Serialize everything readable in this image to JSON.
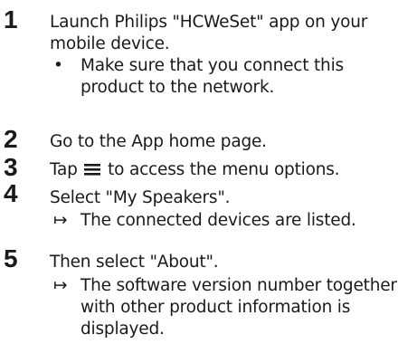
{
  "steps": [
    {
      "number": "1",
      "text": "Launch Philips \"HCWeSet\" app on your mobile device.",
      "sub_marker": "•",
      "sub_text": "Make sure that you connect this product to the network."
    },
    {
      "number": "2",
      "text": "Go to the App home page."
    },
    {
      "number": "3",
      "text_before_icon": "Tap",
      "icon": "menu-icon",
      "text_after_icon": "to access the menu options."
    },
    {
      "number": "4",
      "text": "Select \"My Speakers\".",
      "sub_marker": "↦",
      "sub_text": "The connected devices are listed."
    },
    {
      "number": "5",
      "text": "Then select \"About\".",
      "sub_marker": "↦",
      "sub_text": "The software version number together with other product information is displayed."
    }
  ]
}
